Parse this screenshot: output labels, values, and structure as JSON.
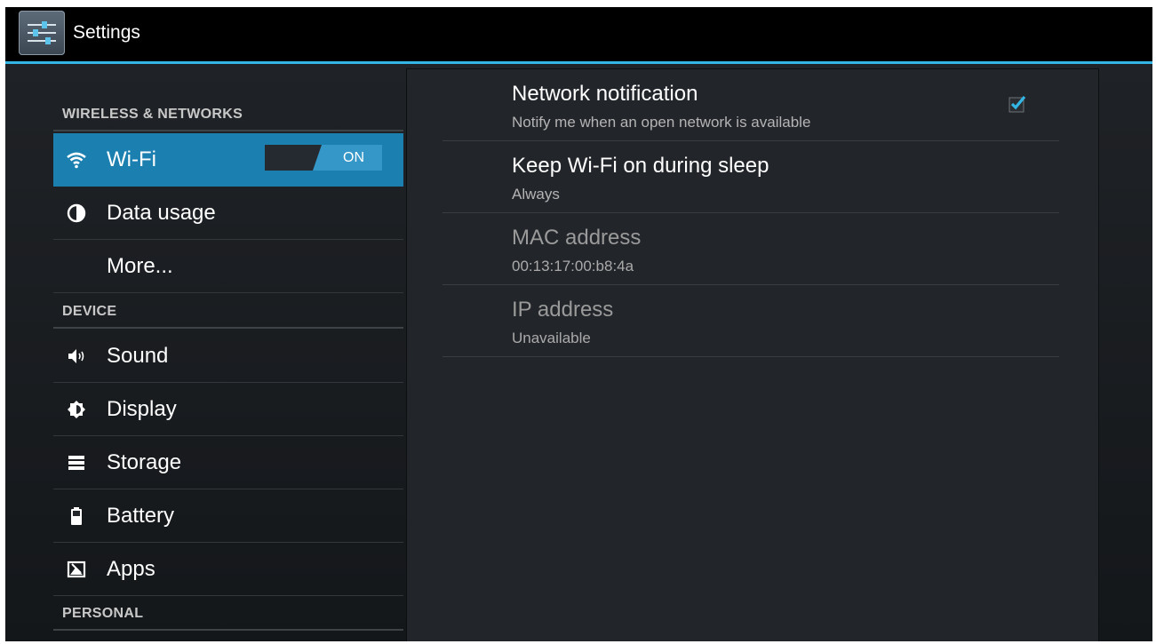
{
  "app": {
    "title": "Settings",
    "icon": "settings-sliders-icon",
    "accent_color": "#33b5e5"
  },
  "nav": {
    "sections": [
      {
        "header": "WIRELESS & NETWORKS"
      },
      {
        "header": "DEVICE"
      },
      {
        "header": "PERSONAL"
      }
    ],
    "items": [
      {
        "label": "Wi-Fi",
        "icon": "wifi-icon",
        "selected": true,
        "toggle": "ON"
      },
      {
        "label": "Data usage",
        "icon": "data-usage-icon"
      },
      {
        "label": "More..."
      },
      {
        "label": "Sound",
        "icon": "sound-icon"
      },
      {
        "label": "Display",
        "icon": "display-icon"
      },
      {
        "label": "Storage",
        "icon": "storage-icon"
      },
      {
        "label": "Battery",
        "icon": "battery-icon"
      },
      {
        "label": "Apps",
        "icon": "apps-icon"
      }
    ],
    "selected_color": "#1b7fb0"
  },
  "detail": {
    "prefs": [
      {
        "title": "Network notification",
        "summary": "Notify me when an open network is available",
        "checked": true
      },
      {
        "title": "Keep Wi-Fi on during sleep",
        "summary": "Always"
      },
      {
        "title": "MAC address",
        "summary": "00:13:17:00:b8:4a"
      },
      {
        "title": "IP address",
        "summary": "Unavailable"
      }
    ]
  }
}
